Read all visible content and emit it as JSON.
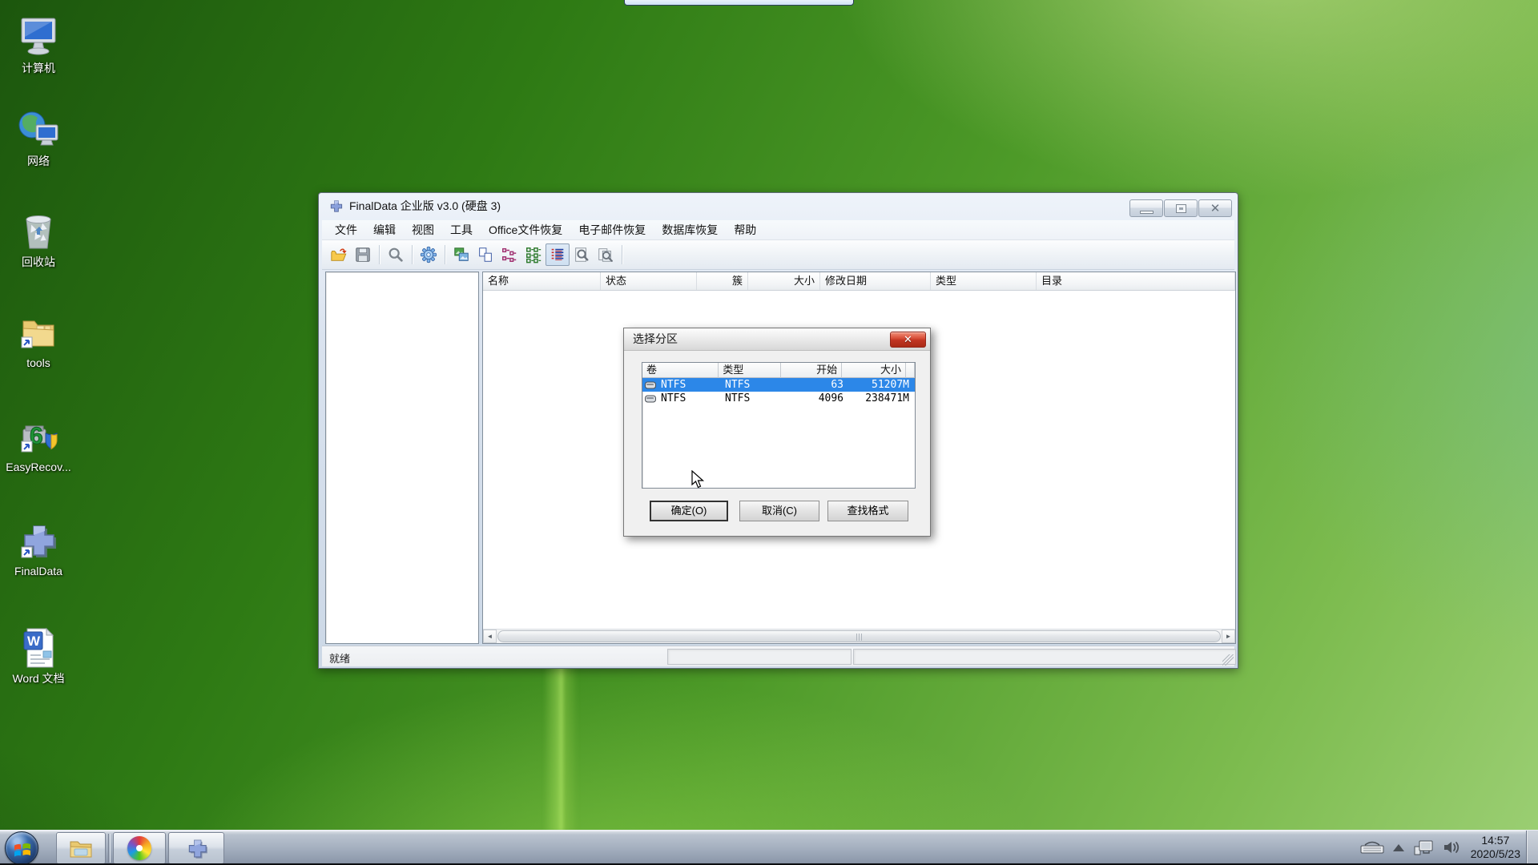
{
  "desktop": {
    "icons": [
      {
        "label": "计算机"
      },
      {
        "label": "网络"
      },
      {
        "label": "回收站"
      },
      {
        "label": "tools"
      },
      {
        "label": "EasyRecov..."
      },
      {
        "label": "FinalData"
      },
      {
        "label": "Word 文档"
      }
    ]
  },
  "app": {
    "title": "FinalData 企业版 v3.0 (硬盘 3)",
    "menu": [
      "文件",
      "编辑",
      "视图",
      "工具",
      "Office文件恢复",
      "电子邮件恢复",
      "数据库恢复",
      "帮助"
    ],
    "toolbar_icons": [
      "open-folder",
      "save",
      "search",
      "settings-gear",
      "image-view",
      "copy-pages",
      "small-icons-view",
      "large-icons-view",
      "details-view",
      "zoom-document",
      "find-document"
    ],
    "list_columns": [
      "名称",
      "状态",
      "簇",
      "大小",
      "修改日期",
      "类型",
      "目录"
    ],
    "status": "就绪"
  },
  "dialog": {
    "title": "选择分区",
    "columns": [
      "卷",
      "类型",
      "开始",
      "大小"
    ],
    "rows": [
      {
        "volume": "NTFS",
        "type": "NTFS",
        "start": "63",
        "size": "51207M",
        "selected": true
      },
      {
        "volume": "NTFS",
        "type": "NTFS",
        "start": "4096",
        "size": "238471M",
        "selected": false
      }
    ],
    "buttons": {
      "ok": "确定(O)",
      "cancel": "取消(C)",
      "find_format": "查找格式"
    }
  },
  "taskbar": {
    "clock": {
      "time": "14:57",
      "date": "2020/5/23"
    }
  }
}
